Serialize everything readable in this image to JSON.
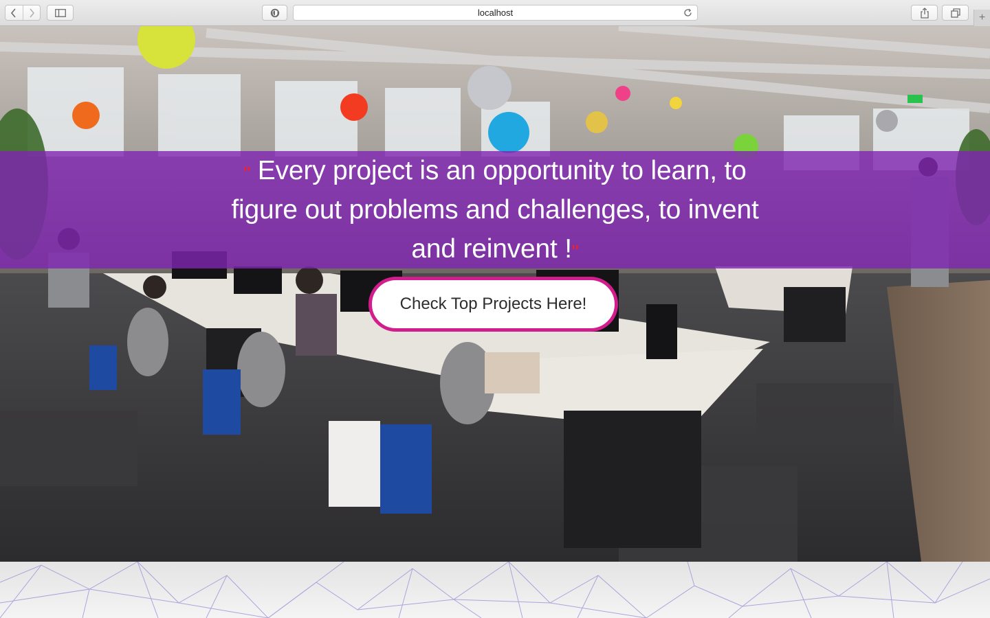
{
  "browser": {
    "url": "localhost",
    "icons": {
      "back": "chevron-left-icon",
      "forward": "chevron-right-icon",
      "sidebar": "sidebar-icon",
      "privacy": "shield-icon",
      "reload": "reload-icon",
      "share": "share-icon",
      "tabs": "tabs-overview-icon",
      "new_tab": "plus-icon"
    }
  },
  "hero": {
    "quote_open": "\"",
    "quote_line1": "Every project is an opportunity to learn, to",
    "quote_line2": "figure out problems and challenges, to invent",
    "quote_line3": "and reinvent !",
    "quote_close": "\"",
    "cta_label": "Check Top Projects Here!"
  },
  "colors": {
    "band": "#8024b2",
    "cta_border": "#d21e8c",
    "quote_mark": "#ff1d1d"
  }
}
